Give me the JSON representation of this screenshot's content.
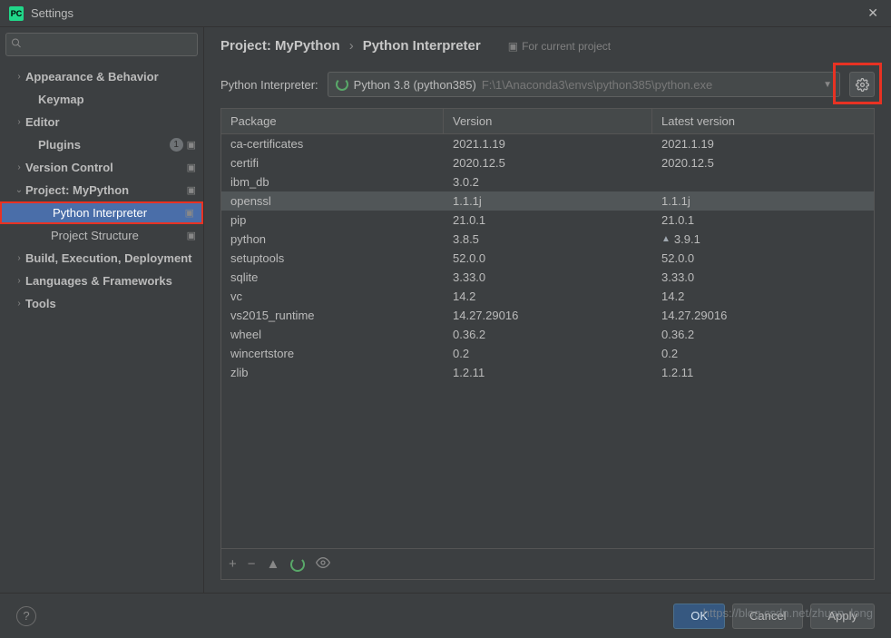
{
  "window": {
    "title": "Settings"
  },
  "sidebar": {
    "search_placeholder": "",
    "items": [
      {
        "label": "Appearance & Behavior",
        "arrow": "›",
        "indent": 14,
        "bold": true
      },
      {
        "label": "Keymap",
        "arrow": "",
        "indent": 28,
        "bold": true
      },
      {
        "label": "Editor",
        "arrow": "›",
        "indent": 14,
        "bold": true
      },
      {
        "label": "Plugins",
        "arrow": "",
        "indent": 28,
        "bold": true,
        "badge": "1",
        "mod": true
      },
      {
        "label": "Version Control",
        "arrow": "›",
        "indent": 14,
        "bold": true,
        "mod": true
      },
      {
        "label": "Project: MyPython",
        "arrow": "⌄",
        "indent": 14,
        "bold": true,
        "mod": true
      },
      {
        "label": "Python Interpreter",
        "arrow": "",
        "indent": 42,
        "bold": false,
        "selected": true,
        "mod": true,
        "redbox": true
      },
      {
        "label": "Project Structure",
        "arrow": "",
        "indent": 42,
        "bold": false,
        "mod": true
      },
      {
        "label": "Build, Execution, Deployment",
        "arrow": "›",
        "indent": 14,
        "bold": true
      },
      {
        "label": "Languages & Frameworks",
        "arrow": "›",
        "indent": 14,
        "bold": true
      },
      {
        "label": "Tools",
        "arrow": "›",
        "indent": 14,
        "bold": true
      }
    ]
  },
  "breadcrumb": {
    "crumb1": "Project: MyPython",
    "sep": "›",
    "crumb2": "Python Interpreter",
    "hint": "For current project"
  },
  "interpreter": {
    "label": "Python Interpreter:",
    "name": "Python 3.8 (python385)",
    "path": "F:\\1\\Anaconda3\\envs\\python385\\python.exe"
  },
  "table": {
    "headers": {
      "pkg": "Package",
      "ver": "Version",
      "lat": "Latest version"
    },
    "rows": [
      {
        "pkg": "ca-certificates",
        "ver": "2021.1.19",
        "lat": "2021.1.19"
      },
      {
        "pkg": "certifi",
        "ver": "2020.12.5",
        "lat": "2020.12.5"
      },
      {
        "pkg": "ibm_db",
        "ver": "3.0.2",
        "lat": ""
      },
      {
        "pkg": "openssl",
        "ver": "1.1.1j",
        "lat": "1.1.1j",
        "sel": true
      },
      {
        "pkg": "pip",
        "ver": "21.0.1",
        "lat": "21.0.1"
      },
      {
        "pkg": "python",
        "ver": "3.8.5",
        "lat": "3.9.1",
        "up": true
      },
      {
        "pkg": "setuptools",
        "ver": "52.0.0",
        "lat": "52.0.0"
      },
      {
        "pkg": "sqlite",
        "ver": "3.33.0",
        "lat": "3.33.0"
      },
      {
        "pkg": "vc",
        "ver": "14.2",
        "lat": "14.2"
      },
      {
        "pkg": "vs2015_runtime",
        "ver": "14.27.29016",
        "lat": "14.27.29016"
      },
      {
        "pkg": "wheel",
        "ver": "0.36.2",
        "lat": "0.36.2"
      },
      {
        "pkg": "wincertstore",
        "ver": "0.2",
        "lat": "0.2"
      },
      {
        "pkg": "zlib",
        "ver": "1.2.11",
        "lat": "1.2.11"
      }
    ]
  },
  "footer": {
    "ok": "OK",
    "cancel": "Cancel",
    "apply": "Apply"
  },
  "watermark": "https://blog.csdn.net/zhuan_long"
}
